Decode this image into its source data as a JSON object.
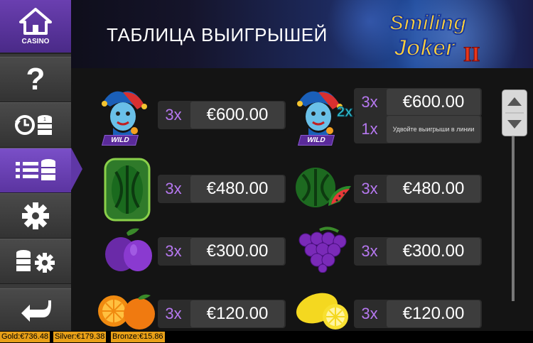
{
  "header": {
    "title": "ТАБЛИЦА ВЫИГРЫШЕЙ",
    "logo_line1": "Smiling",
    "logo_line2": "Joker",
    "logo_suffix": "II"
  },
  "sidebar": {
    "casino_label": "CASINO",
    "help_glyph": "?"
  },
  "paytable": [
    {
      "symbol": "joker-wild",
      "badge": "WILD",
      "mult": "3x",
      "prize": "€600.00"
    },
    {
      "symbol": "joker-wild-2x",
      "badge": "WILD",
      "overlay": "2x",
      "mult": "3x",
      "prize": "€600.00",
      "mult2": "1x",
      "note": "Удвойте выигрыши в линии"
    },
    {
      "symbol": "watermelon-wild",
      "mult": "3x",
      "prize": "€480.00"
    },
    {
      "symbol": "watermelon",
      "mult": "3x",
      "prize": "€480.00"
    },
    {
      "symbol": "plum",
      "mult": "3x",
      "prize": "€300.00"
    },
    {
      "symbol": "grapes",
      "mult": "3x",
      "prize": "€300.00"
    },
    {
      "symbol": "orange",
      "mult": "3x",
      "prize": "€120.00"
    },
    {
      "symbol": "lemon",
      "mult": "3x",
      "prize": "€120.00"
    }
  ],
  "jackpots": {
    "gold": "Gold:€736.48",
    "silver": "Silver:€179.38",
    "bronze": "Bronze:€15.86"
  },
  "colors": {
    "accent": "#6a3fb0",
    "multiplier": "#b678f0",
    "jackpot": "#e8a018"
  }
}
